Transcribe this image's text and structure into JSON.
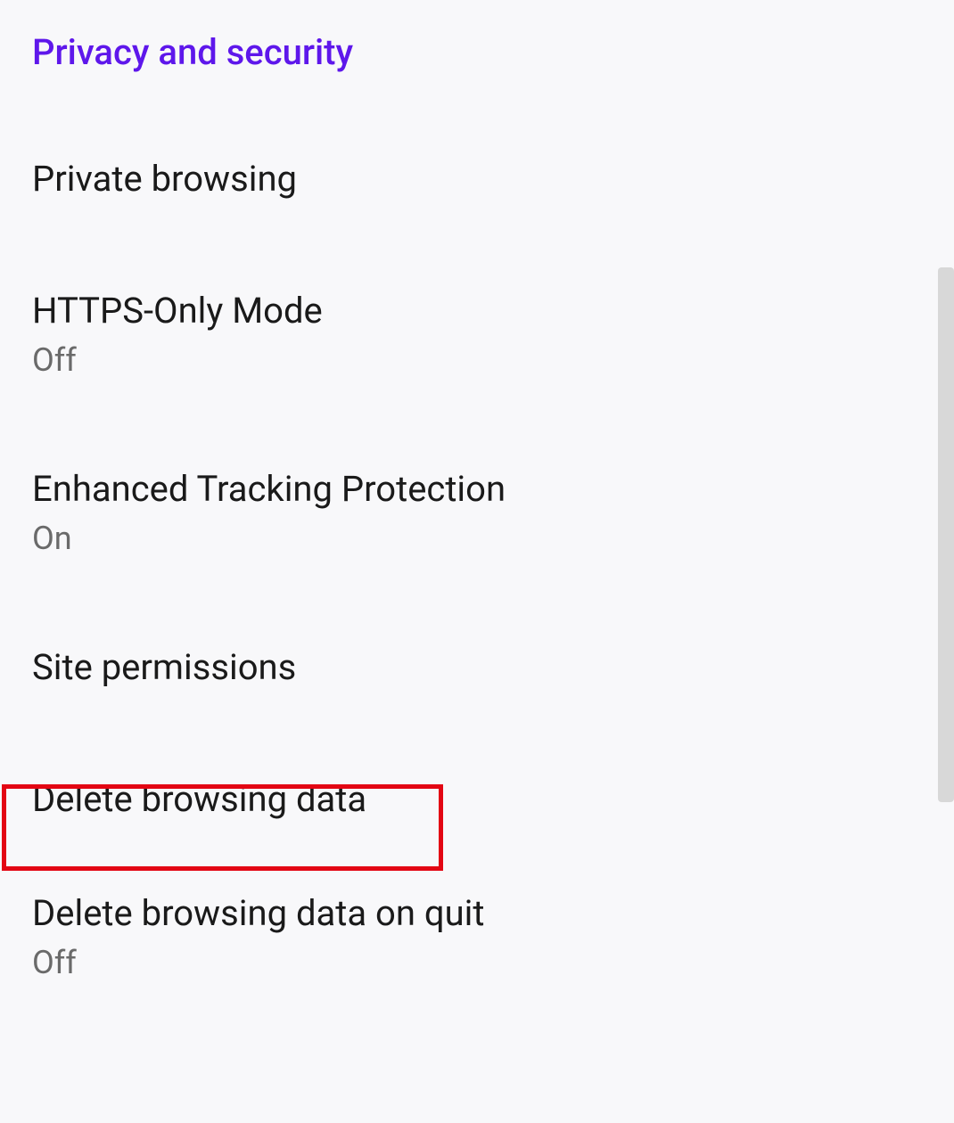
{
  "section": {
    "header": "Privacy and security"
  },
  "settings": {
    "private_browsing": {
      "title": "Private browsing"
    },
    "https_only": {
      "title": "HTTPS-Only Mode",
      "status": "Off"
    },
    "tracking_protection": {
      "title": "Enhanced Tracking Protection",
      "status": "On"
    },
    "site_permissions": {
      "title": "Site permissions"
    },
    "delete_browsing_data": {
      "title": "Delete browsing data"
    },
    "delete_on_quit": {
      "title": "Delete browsing data on quit",
      "status": "Off"
    }
  }
}
